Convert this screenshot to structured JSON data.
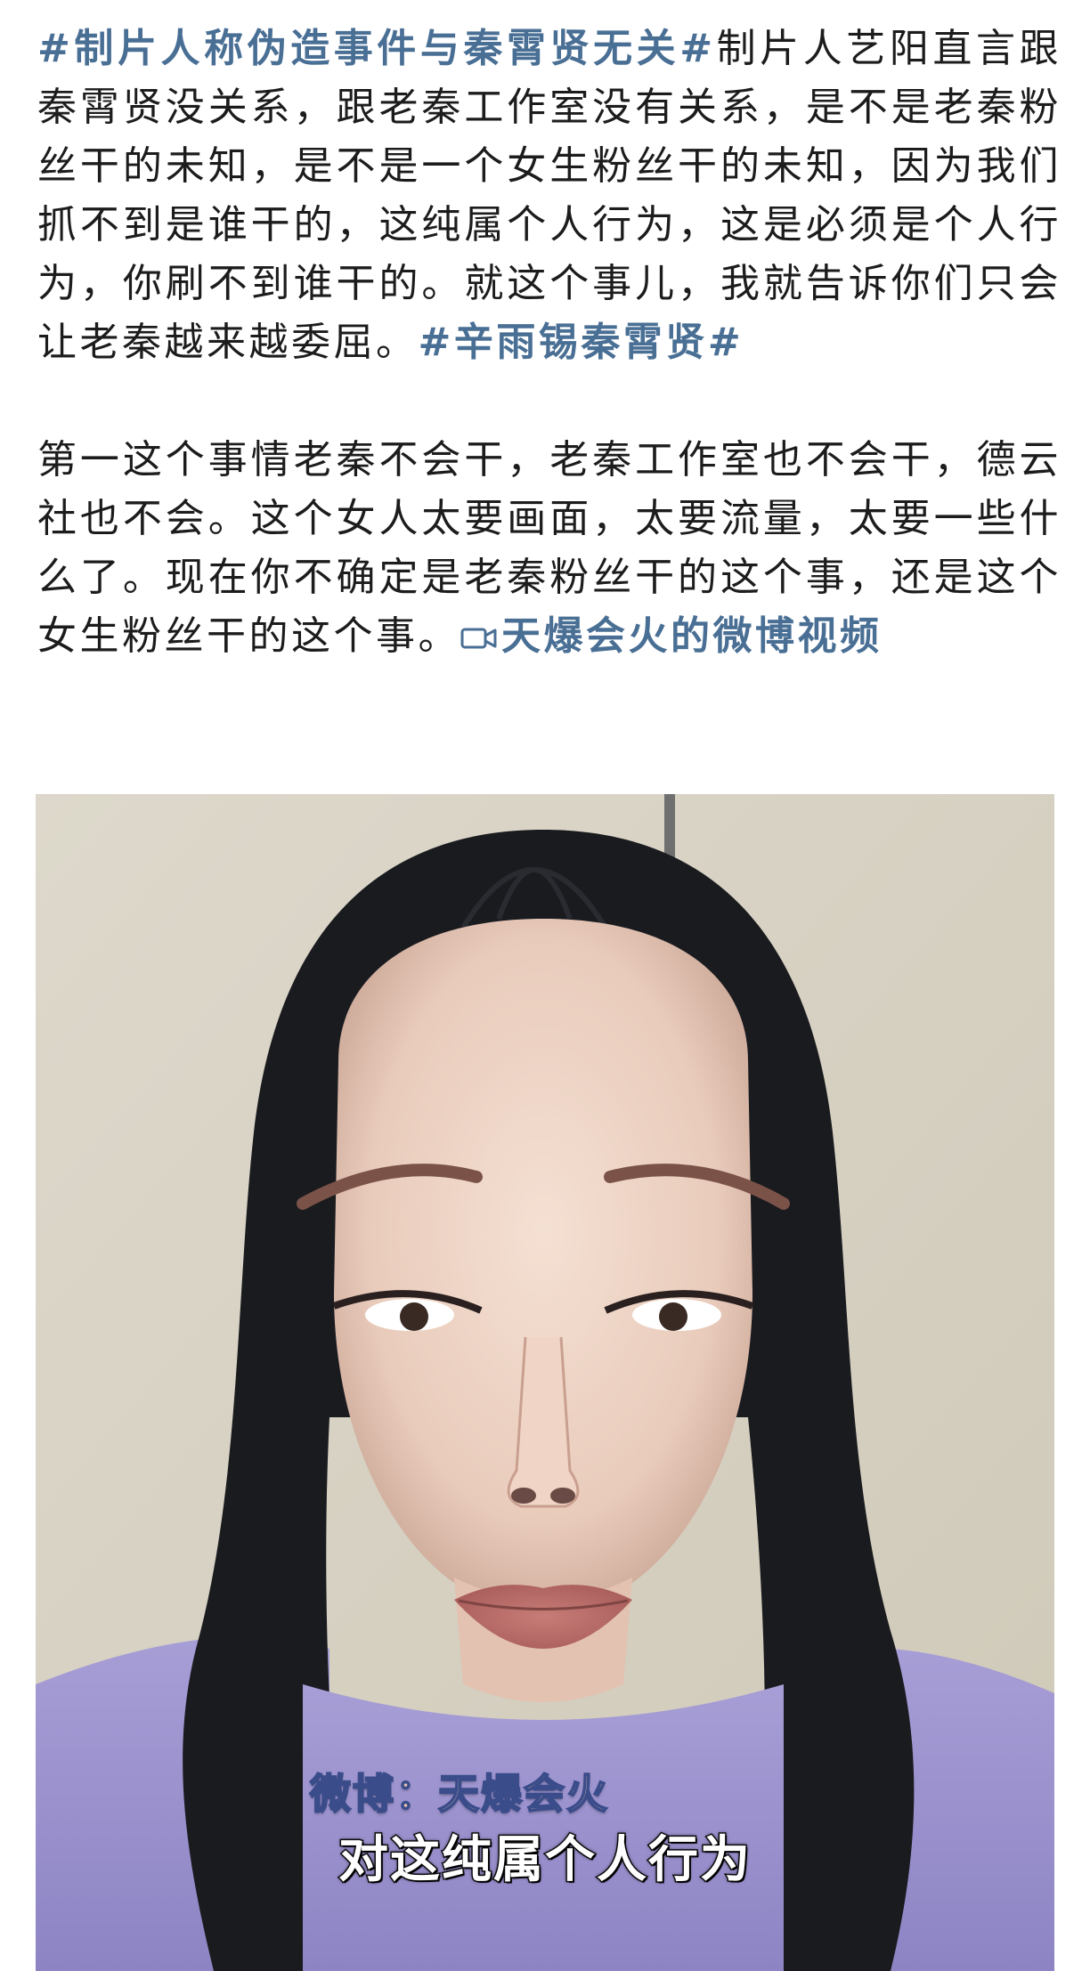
{
  "post": {
    "p1": {
      "hashtag_open": "#制片人称伪造事件与秦霄贤无关#",
      "text": "制片人艺阳直言跟秦霄贤没关系，跟老秦工作室没有关系，是不是老秦粉丝干的未知，是不是一个女生粉丝干的未知，因为我们抓不到是谁干的，这纯属个人行为，这是必须是个人行为，你刷不到谁干的。就这个事儿，我就告诉你们只会让老秦越来越委屈。",
      "hashtag_close": "#辛雨锡秦霄贤#"
    },
    "p2": {
      "text": "第一这个事情老秦不会干，老秦工作室也不会干，德云社也不会。这个女人太要画面，太要流量，太要一些什么了。现在你不确定是老秦粉丝干的这个事，还是这个女生粉丝干的这个事。",
      "video_icon": "video-camera-icon",
      "video_link": "天爆会火的微博视频"
    }
  },
  "video": {
    "watermark": "微博：天爆会火",
    "subtitle": "对这纯属个人行为"
  },
  "colors": {
    "link": "#4a6f95",
    "text": "#1c1c1c",
    "background": "#ffffff"
  }
}
